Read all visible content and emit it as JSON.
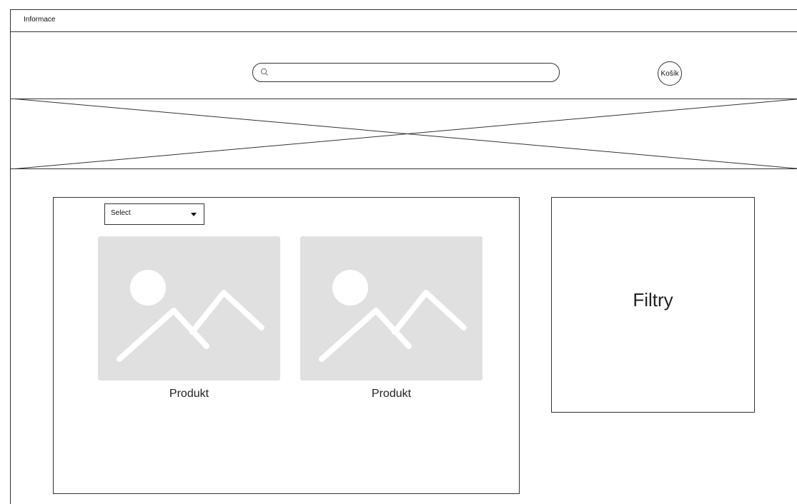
{
  "info_bar": {
    "label": "Informace"
  },
  "header": {
    "search": {
      "placeholder": "",
      "icon": "search-icon"
    },
    "cart": {
      "label": "Košík"
    }
  },
  "hero": {
    "image": "image-placeholder"
  },
  "products": {
    "sort_select": {
      "selected": "Select"
    },
    "items": [
      {
        "label": "Produkt",
        "image": "image-placeholder-icon"
      },
      {
        "label": "Produkt",
        "image": "image-placeholder-icon"
      }
    ]
  },
  "filters": {
    "title": "Filtry"
  },
  "colors": {
    "border": "#333333",
    "placeholder_fill": "#e0e0e0",
    "placeholder_icon": "#ffffff"
  }
}
